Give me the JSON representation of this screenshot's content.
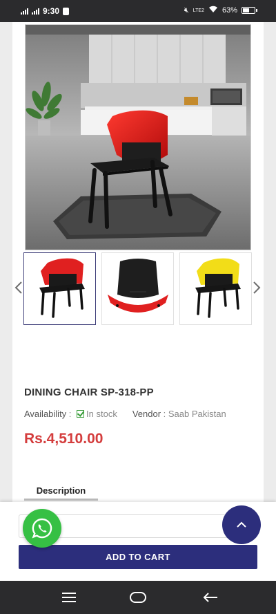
{
  "status_bar": {
    "time": "9:30",
    "battery_text": "63%",
    "battery_level": 0.63,
    "network_label": "LTE2"
  },
  "product": {
    "title": "DINING CHAIR SP-318-PP",
    "availability_label": "Availability",
    "availability_sep": " : ",
    "availability_value": "In stock",
    "vendor_label": "Vendor",
    "vendor_sep": " : ",
    "vendor_value": "Saab Pakistan",
    "price": "Rs.4,510.00"
  },
  "gallery": {
    "thumbnails": [
      {
        "name": "red-chair-front",
        "active": true
      },
      {
        "name": "red-chair-top",
        "active": false
      },
      {
        "name": "yellow-chair-front",
        "active": false
      }
    ]
  },
  "tabs": {
    "description_label": "Description"
  },
  "actions": {
    "add_to_cart_label": "ADD TO CART"
  },
  "icons": {
    "whatsapp": "whatsapp-icon",
    "scroll_top": "chevron-up-icon",
    "prev": "chevron-left-icon",
    "next": "chevron-right-icon",
    "nav_menu": "menu-icon",
    "nav_home": "home-icon",
    "nav_back": "back-icon"
  },
  "colors": {
    "brand": "#2c2e7c",
    "price": "#d43d3d",
    "whatsapp": "#36c044",
    "in_stock": "#3a9d3a"
  }
}
